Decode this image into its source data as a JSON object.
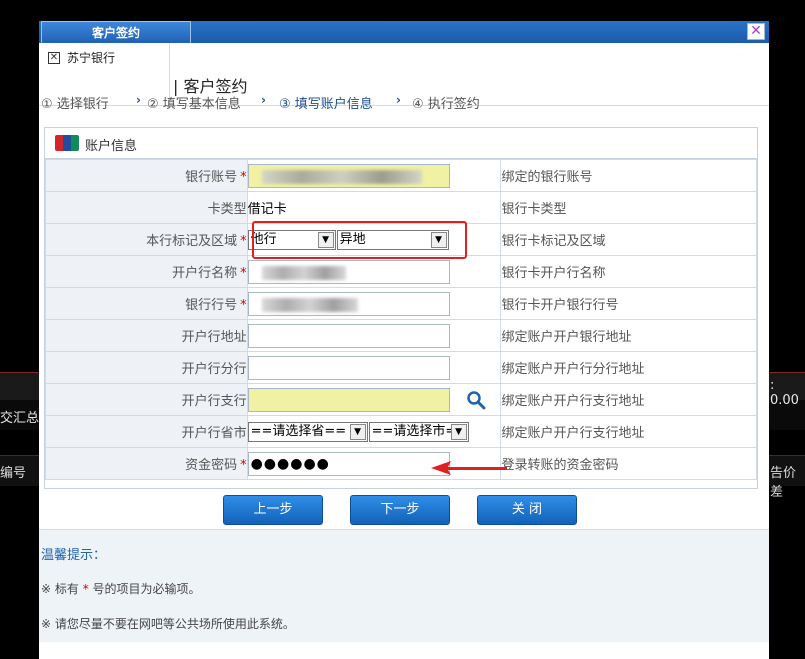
{
  "background": {
    "left_label_1": "交汇总",
    "left_label_2": "编号",
    "right_label_1": ": 0.00",
    "right_label_2": "告价差"
  },
  "dialog": {
    "tab_title": "客户签约",
    "close_label": "✕",
    "bank_name": "苏宁银行",
    "page_title": "| 客户签约"
  },
  "steps": [
    {
      "label": "① 选择银行",
      "active": false
    },
    {
      "label": "② 填写基本信息",
      "active": false
    },
    {
      "label": "③ 填写账户信息",
      "active": true
    },
    {
      "label": "④ 执行签约",
      "active": false
    }
  ],
  "form": {
    "section_title": "账户信息",
    "rows": [
      {
        "label": "银行账号",
        "required": true,
        "description": "绑定的银行账号"
      },
      {
        "label": "卡类型",
        "required": false,
        "value": "借记卡",
        "description": "银行卡类型"
      },
      {
        "label": "本行标记及区域",
        "required": true,
        "select1": "他行",
        "select2": "异地",
        "description": "银行卡标记及区域"
      },
      {
        "label": "开户行名称",
        "required": true,
        "description": "银行卡开户行名称"
      },
      {
        "label": "银行行号",
        "required": true,
        "description": "银行卡开户银行行号"
      },
      {
        "label": "开户行地址",
        "required": false,
        "description": "绑定账户开户银行地址"
      },
      {
        "label": "开户行分行",
        "required": false,
        "description": "绑定账户开户行分行地址"
      },
      {
        "label": "开户行支行",
        "required": false,
        "description": "绑定账户开户行支行地址"
      },
      {
        "label": "开户行省市",
        "required": false,
        "province": "==请选择省==",
        "city": "==请选择市==",
        "description": "绑定账户开户行支行地址"
      },
      {
        "label": "资金密码",
        "required": true,
        "value": "●●●●●●",
        "description": "登录转账的资金密码"
      }
    ]
  },
  "buttons": {
    "prev": "上一步",
    "next": "下一步",
    "close": "关  闭"
  },
  "tips": {
    "title": "温馨提示：",
    "tip1_prefix": "※ 标有",
    "tip1_star": "*",
    "tip1_suffix": "号的项目为必输项。",
    "tip2": "※ 请您尽量不要在网吧等公共场所使用此系统。"
  }
}
